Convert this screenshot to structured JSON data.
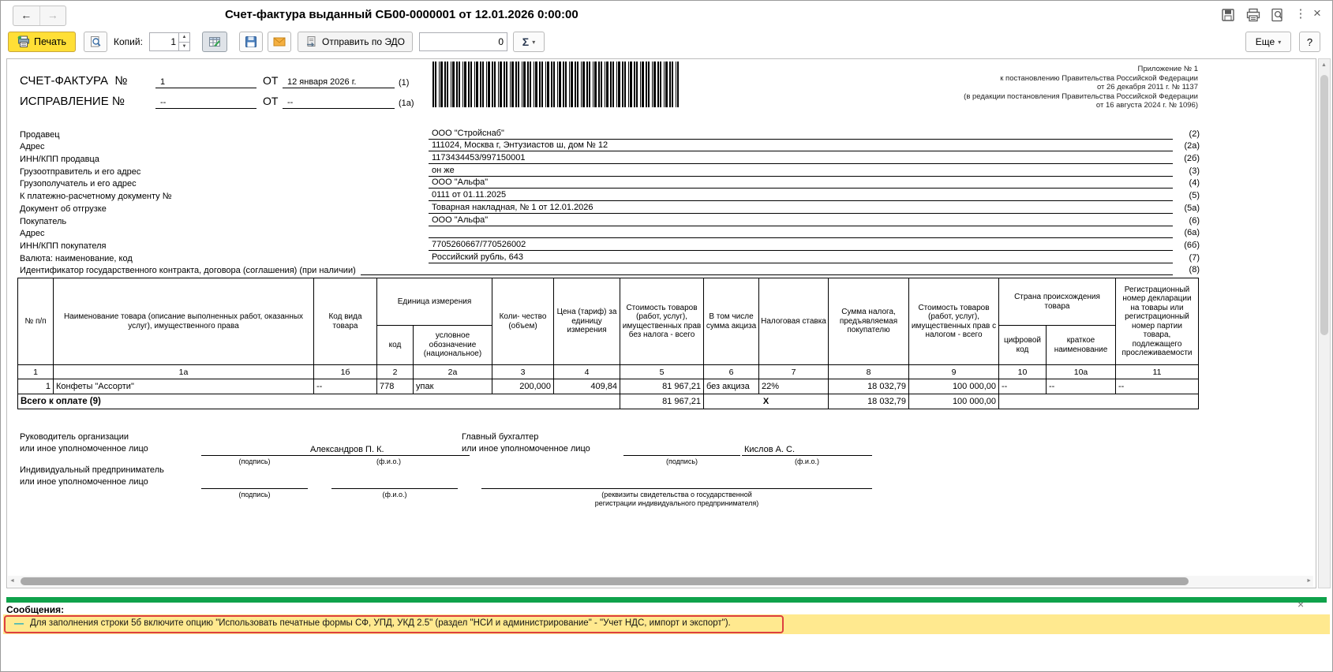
{
  "window": {
    "title": "Счет-фактура выданный СБ00-0000001 от 12.01.2026 0:00:00",
    "more_label": "Еще",
    "help_label": "?"
  },
  "glyphs": {
    "back": "←",
    "forward": "→",
    "kebab": "⋮",
    "close": "×",
    "dropdown": "▾",
    "spin_up": "▲",
    "spin_down": "▼",
    "scroll_left": "◄",
    "scroll_right": "►",
    "message_dash": "—",
    "messages_close": "×"
  },
  "toolbar": {
    "print_label": "Печать",
    "copies_label": "Копий:",
    "copies_value": "1",
    "edo_label": "Отправить по ЭДО",
    "count_value": "0",
    "sigma": "Σ"
  },
  "doc": {
    "legal_lines": [
      "Приложение № 1",
      "к постановлению Правительства Российской Федерации",
      "от 26 декабря 2011 г. № 1137",
      "(в редакции постановления Правительства Российской Федерации",
      "от 16 августа 2024 г. № 1096)"
    ],
    "header": {
      "invoice_label": "СЧЕТ-ФАКТУРА  №",
      "invoice_no": "1",
      "ot1": "ОТ",
      "invoice_date": "12 января 2026 г.",
      "ref1": "(1)",
      "correction_label": "ИСПРАВЛЕНИЕ №",
      "correction_no": "--",
      "ot2": "ОТ",
      "correction_date": "--",
      "ref1a": "(1а)"
    },
    "fields": [
      {
        "label": "Продавец",
        "value": "ООО \"Стройснаб\"",
        "ref": "(2)"
      },
      {
        "label": "Адрес",
        "value": "111024, Москва г, Энтузиастов ш, дом № 12",
        "ref": "(2а)"
      },
      {
        "label": "ИНН/КПП продавца",
        "value": "1173434453/997150001",
        "ref": "(2б)"
      },
      {
        "label": "Грузоотправитель и его адрес",
        "value": "он же",
        "ref": "(3)"
      },
      {
        "label": "Грузополучатель и его адрес",
        "value": "ООО \"Альфа\"",
        "ref": "(4)"
      },
      {
        "label": "К платежно-расчетному документу №",
        "value": "0111 от 01.11.2025",
        "ref": "(5)"
      },
      {
        "label": "Документ об отгрузке",
        "value": "Товарная накладная, № 1 от 12.01.2026",
        "ref": "(5а)"
      },
      {
        "label": "Покупатель",
        "value": "ООО \"Альфа\"",
        "ref": "(6)"
      },
      {
        "label": "Адрес",
        "value": "",
        "ref": "(6а)"
      },
      {
        "label": "ИНН/КПП покупателя",
        "value": "7705260667/770526002",
        "ref": "(6б)"
      },
      {
        "label": "Валюта: наименование, код",
        "value": "Российский рубль, 643",
        "ref": "(7)"
      },
      {
        "label": "Идентификатор государственного контракта, договора (соглашения) (при наличии)",
        "value": "",
        "ref": "(8)"
      }
    ],
    "table": {
      "h": {
        "num": "№ п/п",
        "name": "Наименование товара (описание выполненных работ, оказанных услуг), имущественного права",
        "kind_code": "Код вида товара",
        "unit_group": "Единица измерения",
        "unit_code": "код",
        "unit_symbol": "условное обозначение (национальное)",
        "qty": "Коли- чество (объем)",
        "price": "Цена (тариф) за единицу измерения",
        "cost_wo_tax": "Стоимость товаров (работ, услуг), имущественных прав без налога - всего",
        "excise": "В том числе сумма акциза",
        "tax_rate": "Налоговая ставка",
        "tax_amount": "Сумма налога, предъявляемая покупателю",
        "cost_with_tax": "Стоимость товаров (работ, услуг), имущественных прав с налогом - всего",
        "country_group": "Страна происхождения товара",
        "country_code": "цифровой код",
        "country_name": "краткое наименование",
        "reg_number": "Регистрационный номер декларации на товары или регистрационный номер партии товара, подлежащего прослеживаемости"
      },
      "number_row": [
        "1",
        "1а",
        "1б",
        "2",
        "2а",
        "3",
        "4",
        "5",
        "6",
        "7",
        "8",
        "9",
        "10",
        "10а",
        "11"
      ],
      "rows": [
        [
          "1",
          "Конфеты \"Ассорти\"",
          "--",
          "778",
          "упак",
          "200,000",
          "409,84",
          "81 967,21",
          "без акциза",
          "22%",
          "18 032,79",
          "100 000,00",
          "--",
          "--",
          "--"
        ]
      ],
      "total": {
        "label": "Всего к оплате (9)",
        "cost_wo_tax": "81 967,21",
        "x": "X",
        "tax": "18 032,79",
        "cost_with_tax": "100 000,00"
      }
    },
    "signatures": {
      "head_title1": "Руководитель организации",
      "head_title2": "или иное уполномоченное лицо",
      "sign_caption": "(подпись)",
      "name_caption": "(ф.и.о.)",
      "head_name": "Александров П. К.",
      "acc_title1": "Главный бухгалтер",
      "acc_title2": "или иное уполномоченное лицо",
      "acc_name": "Кислов А. С.",
      "ip_title1": "Индивидуальный предприниматель",
      "ip_title2": "или иное уполномоченное лицо",
      "ip_details_caption1": "(реквизиты свидетельства о государственной",
      "ip_details_caption2": "регистрации индивидуального предпринимателя)"
    }
  },
  "messages": {
    "title": "Сообщения:",
    "item_text": "Для заполнения строки 5б включите опцию \"Использовать печатные формы СФ, УПД, УКД 2.5\" (раздел \"НСИ и администрирование\" - \"Учет НДС, импорт и экспорт\")."
  }
}
